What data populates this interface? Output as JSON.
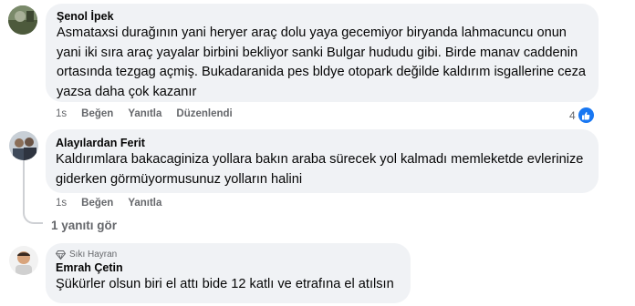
{
  "comments": [
    {
      "author": "Şenol İpek",
      "text": "Asmataxsi durağının yani heryer araç dolu yaya gecemiyor biryanda lahmacuncu onun yani iki sıra araç yayalar birbini bekliyor sanki Bulgar hududu gibi. Birde manav caddenin ortasında tezgag açmiş. Bukadaranida pes bldye otopark değilde kaldırım isgallerine ceza yazsa daha çok kazanır",
      "time": "1s",
      "like_label": "Beğen",
      "reply_label": "Yanıtla",
      "edited_label": "Düzenlendi",
      "reaction_count": "4",
      "reaction_icon": "like-icon",
      "accent": "#1877f2"
    },
    {
      "author": "Alayılardan Ferit",
      "text": "Kaldırımlara bakacaginiza yollara bakın araba sürecek yol kalmadı memleketde evlerinize giderken görmüyormusunuz yolların halini",
      "time": "1s",
      "like_label": "Beğen",
      "reply_label": "Yanıtla",
      "view_replies": "1 yanıtı gör"
    },
    {
      "badge": "Sıkı Hayran",
      "badge_icon": "diamond-icon",
      "author": "Emrah Çetin",
      "text": "Şükürler olsun biri el attı bide 12 katlı ve etrafına el atılsın"
    }
  ]
}
